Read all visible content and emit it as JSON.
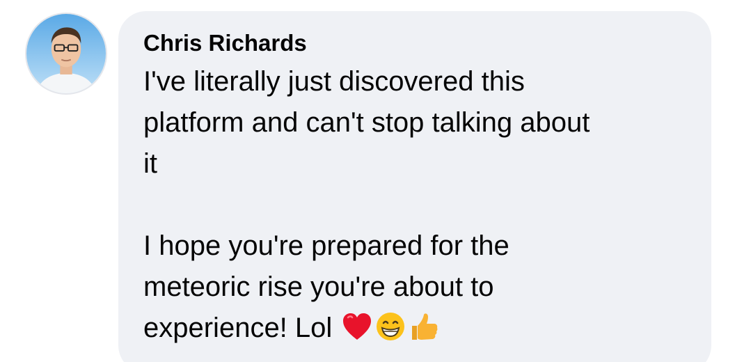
{
  "comment": {
    "author": "Chris Richards",
    "lines": [
      "I've literally just discovered this",
      "platform and can't stop talking about",
      "it",
      "",
      "I hope you're prepared for the",
      "meteoric rise you're about to",
      "experience! Lol"
    ],
    "emojis": [
      "heart-icon",
      "grinning-face-icon",
      "thumbs-up-icon"
    ],
    "colors": {
      "bubble": "#eff1f5",
      "text": "#050505",
      "heart": "#e8132b",
      "emoji_face": "#fcc21b",
      "thumb": "#f9b233"
    }
  }
}
